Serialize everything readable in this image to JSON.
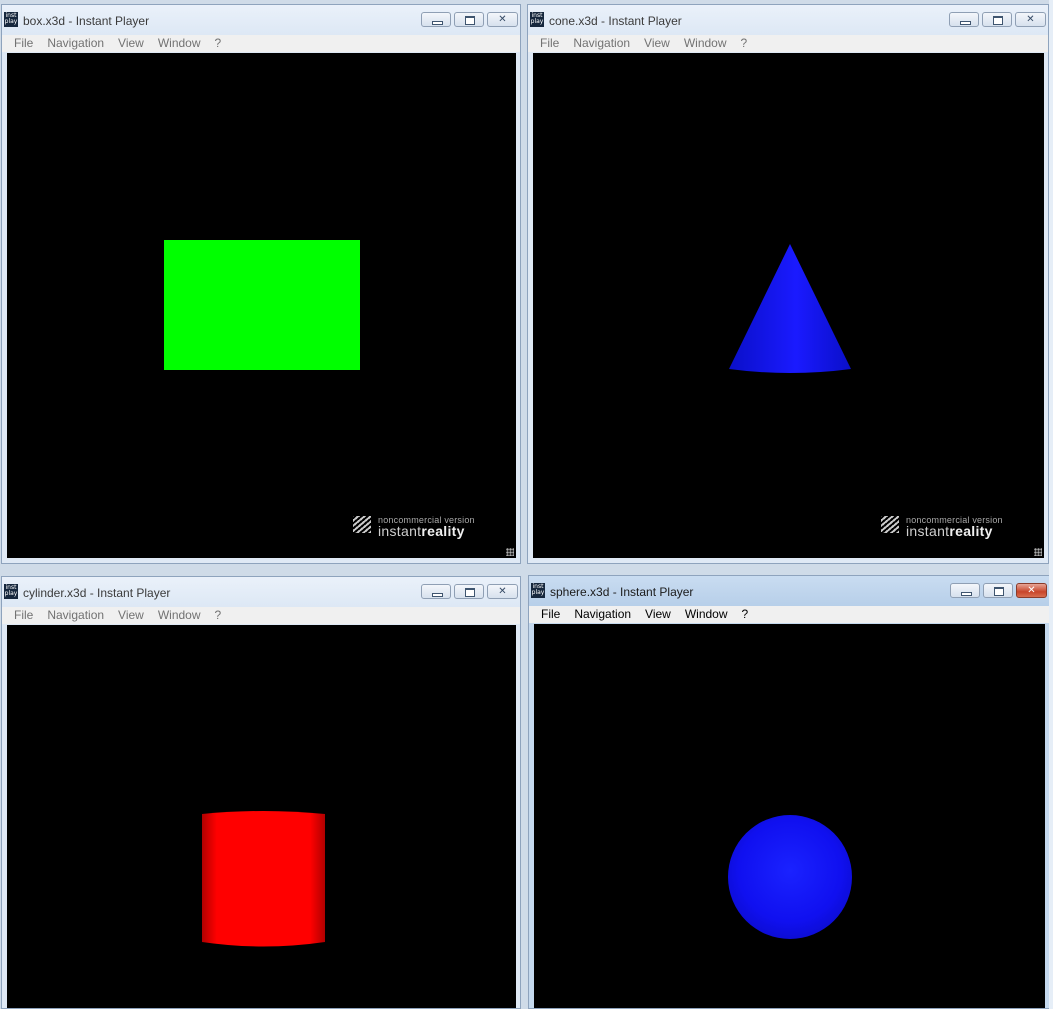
{
  "windows": [
    {
      "id": "box",
      "title": "box.x3d - Instant Player",
      "active": false,
      "menu": [
        "File",
        "Navigation",
        "View",
        "Window",
        "?"
      ],
      "shape": "box",
      "shape_color": "#00ff00",
      "watermark": {
        "small": "noncommercial version",
        "big_light": "instant",
        "big_bold": "reality"
      }
    },
    {
      "id": "cone",
      "title": "cone.x3d - Instant Player",
      "active": false,
      "menu": [
        "File",
        "Navigation",
        "View",
        "Window",
        "?"
      ],
      "shape": "cone",
      "shape_color": "#1000ff",
      "watermark": {
        "small": "noncommercial version",
        "big_light": "instant",
        "big_bold": "reality"
      }
    },
    {
      "id": "cylinder",
      "title": "cylinder.x3d - Instant Player",
      "active": false,
      "menu": [
        "File",
        "Navigation",
        "View",
        "Window",
        "?"
      ],
      "shape": "cylinder",
      "shape_color": "#ff0000"
    },
    {
      "id": "sphere",
      "title": "sphere.x3d - Instant Player",
      "active": true,
      "menu": [
        "File",
        "Navigation",
        "View",
        "Window",
        "?"
      ],
      "shape": "sphere",
      "shape_color": "#0a14ff"
    }
  ],
  "icons": {
    "app": "instant-player-icon",
    "minimize": "minimize-icon",
    "maximize": "maximize-icon",
    "close": "close-icon"
  },
  "app_icon_text": [
    "inst",
    "play"
  ]
}
